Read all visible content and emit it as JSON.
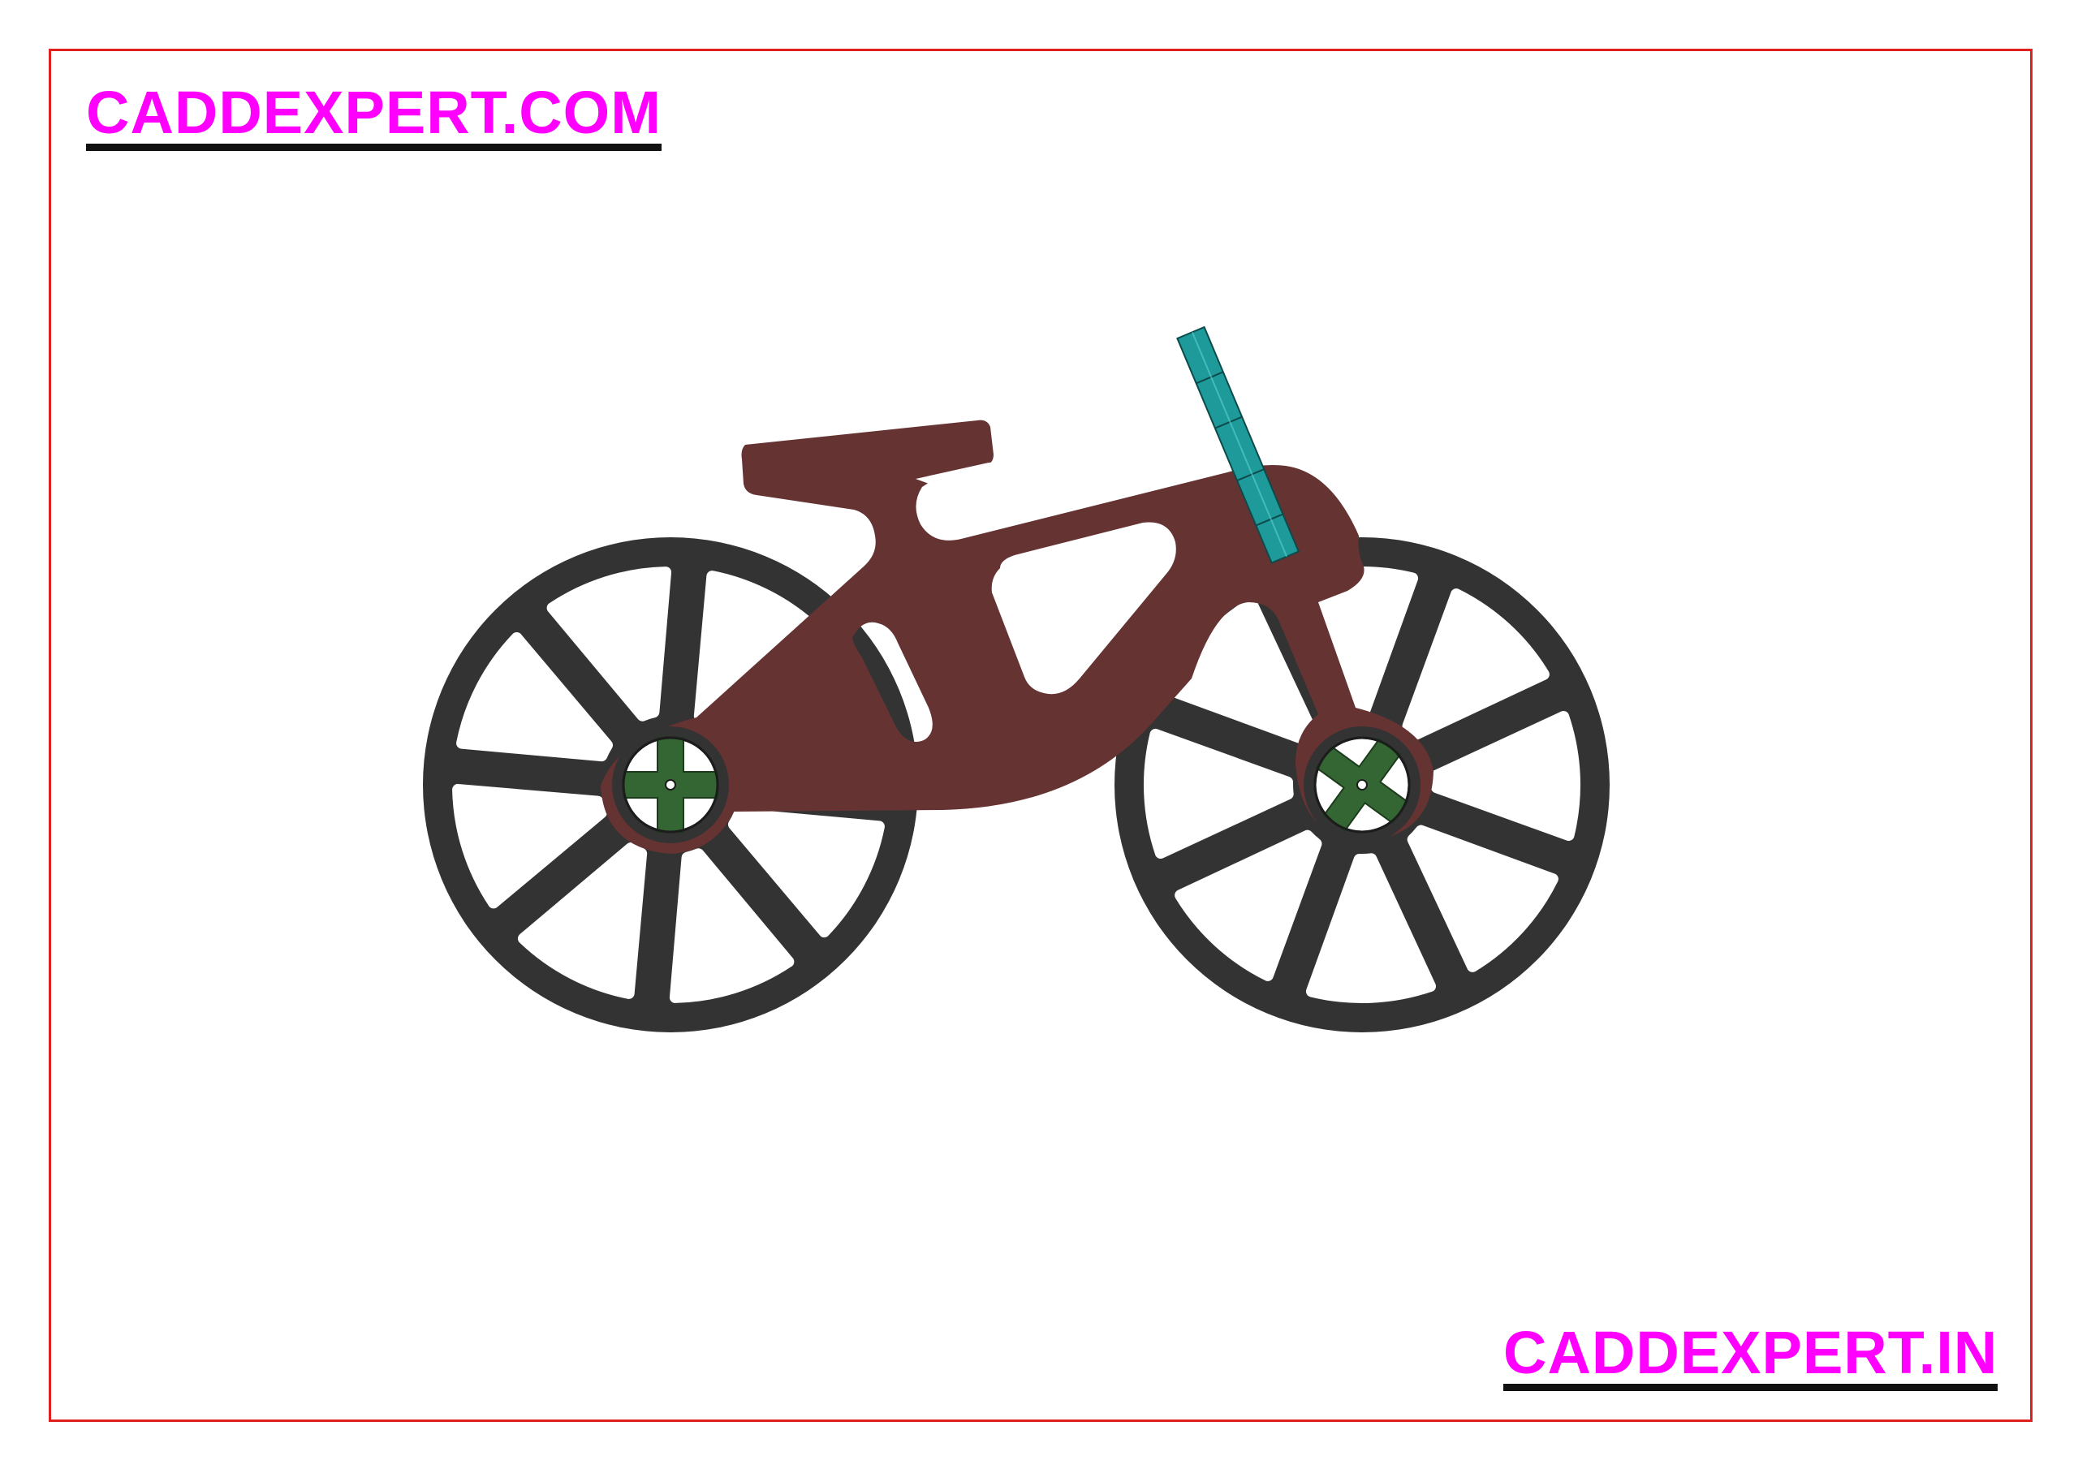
{
  "watermarks": {
    "top_left": "CADDEXPERT.COM",
    "bottom_right": "CADDEXPERT.IN"
  },
  "colors": {
    "page_background": "#ffffff",
    "frame_border": "#e0201e",
    "watermark_text": "#ff00ff",
    "watermark_underline": "#111111",
    "wheel": "#333333",
    "frame_body": "#663333",
    "hub": "#336633",
    "handlebar": "#1e9a9a"
  },
  "model": {
    "wheel_count": 2,
    "spokes_per_wheel": 8
  }
}
